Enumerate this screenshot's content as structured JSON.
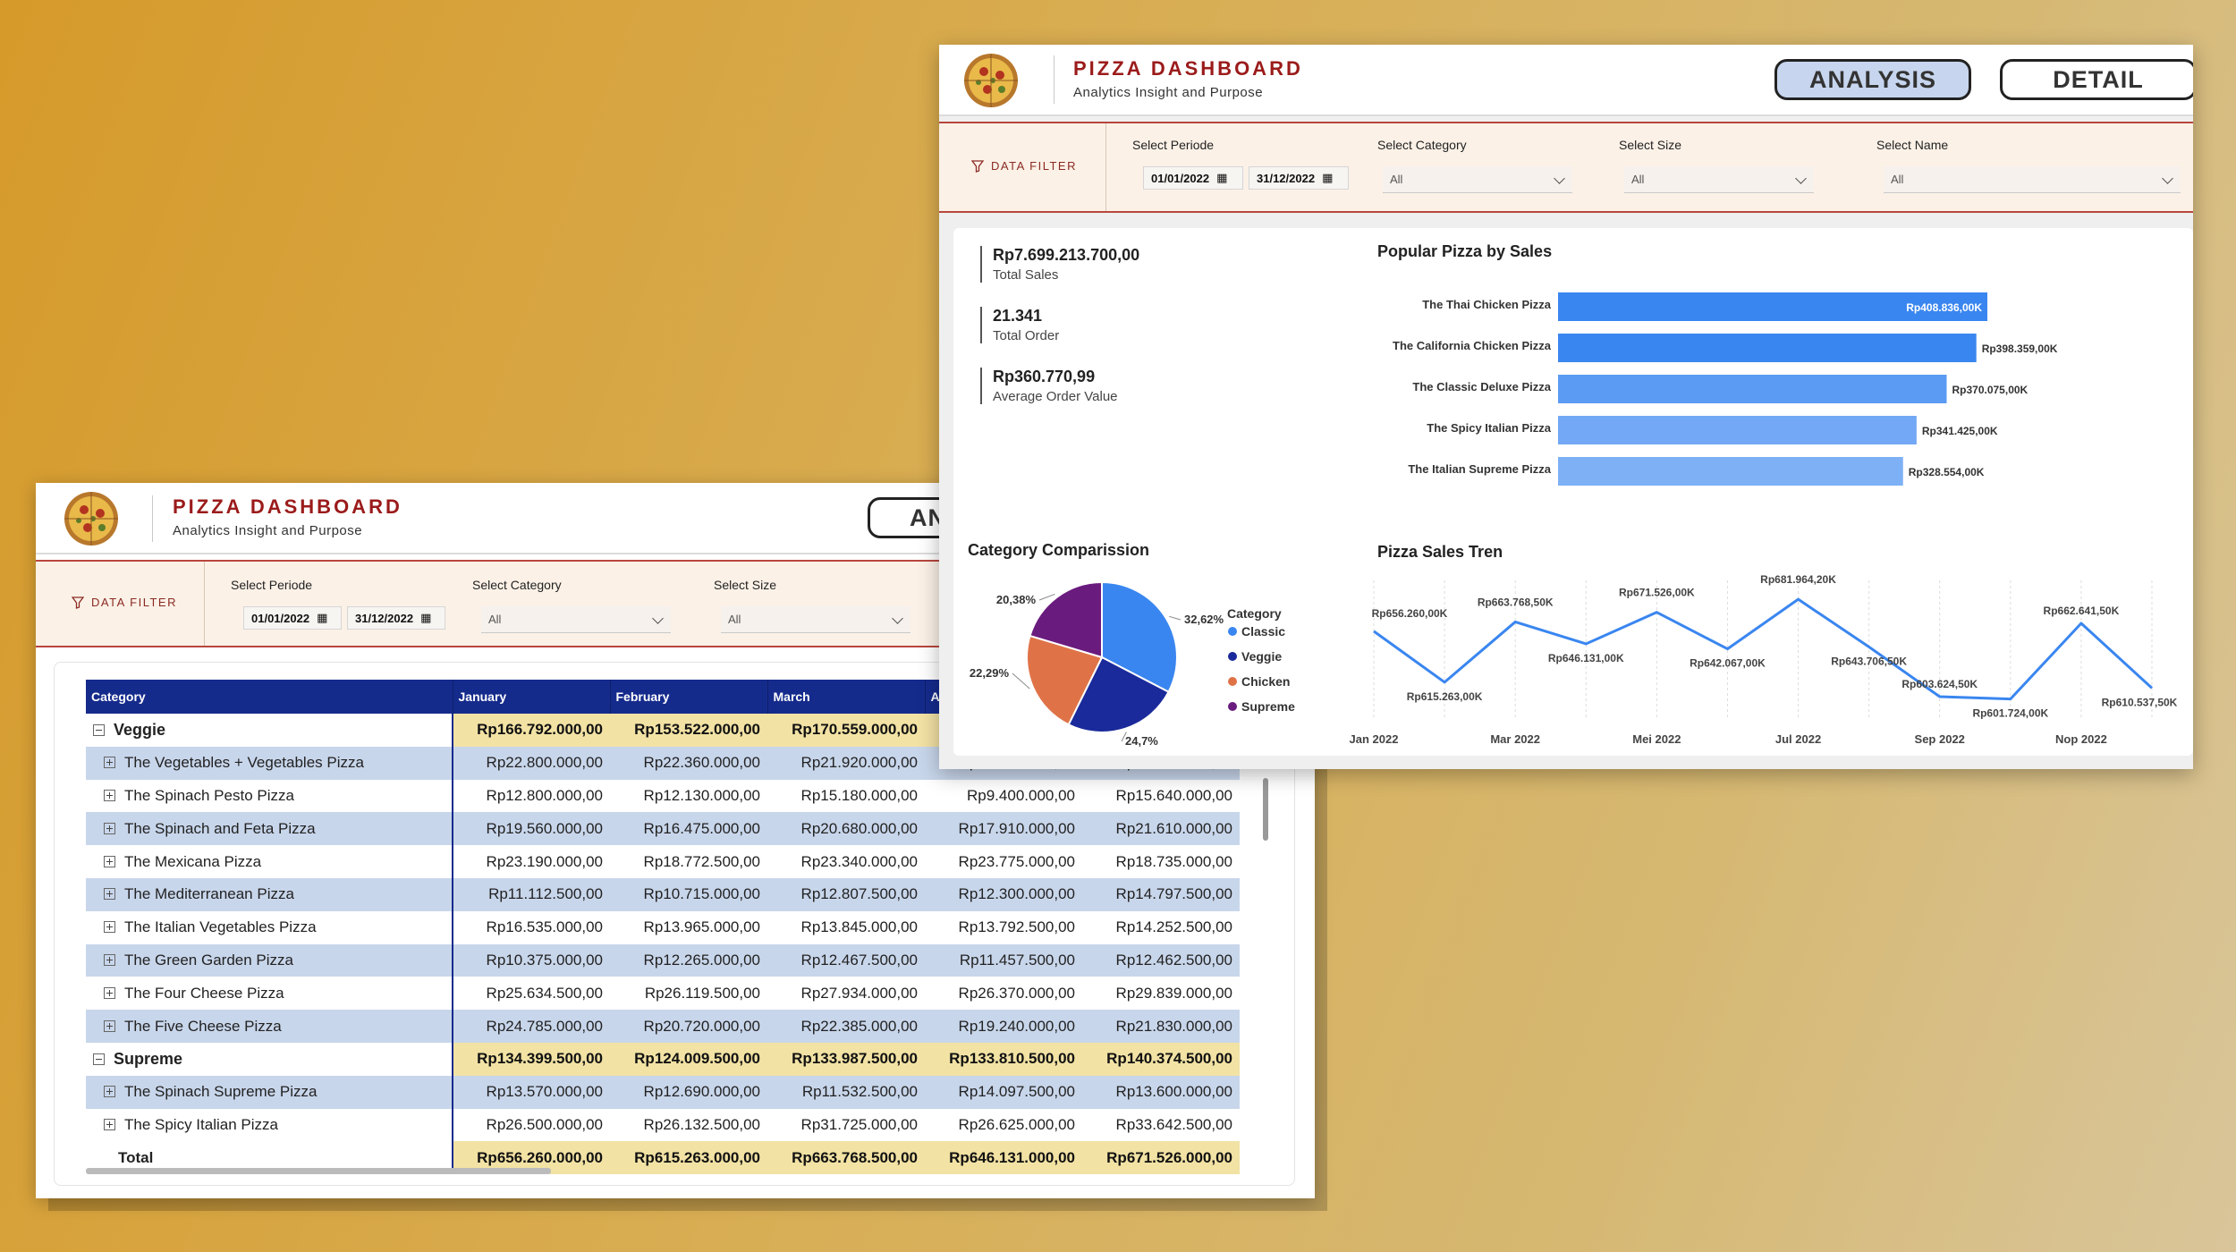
{
  "back_window": {
    "header": {
      "title": "PIZZA DASHBOARD",
      "subtitle": "Analytics Insight and Purpose",
      "nav_partial": "AN"
    },
    "filter": {
      "label": "DATA FILTER",
      "periode_label": "Select Periode",
      "date_from": "01/01/2022",
      "date_to": "31/12/2022",
      "category_label": "Select Category",
      "category_value": "All",
      "size_label": "Select Size",
      "size_value": "All"
    },
    "table": {
      "headers": [
        "Category",
        "January",
        "February",
        "March",
        "A"
      ],
      "rows": [
        {
          "type": "group",
          "label": "Veggie",
          "values": [
            "Rp166.792.000,00",
            "Rp153.522.000,00",
            "Rp170.559.000,00",
            "R",
            ""
          ]
        },
        {
          "type": "item",
          "alt": true,
          "label": "The Vegetables + Vegetables Pizza",
          "values": [
            "Rp22.800.000,00",
            "Rp22.360.000,00",
            "Rp21.920.000,00",
            "Rp20.880.000,00",
            "Rp17.120.000,00"
          ]
        },
        {
          "type": "item",
          "alt": false,
          "label": "The Spinach Pesto Pizza",
          "values": [
            "Rp12.800.000,00",
            "Rp12.130.000,00",
            "Rp15.180.000,00",
            "Rp9.400.000,00",
            "Rp15.640.000,00"
          ]
        },
        {
          "type": "item",
          "alt": true,
          "label": "The Spinach and Feta Pizza",
          "values": [
            "Rp19.560.000,00",
            "Rp16.475.000,00",
            "Rp20.680.000,00",
            "Rp17.910.000,00",
            "Rp21.610.000,00"
          ]
        },
        {
          "type": "item",
          "alt": false,
          "label": "The Mexicana Pizza",
          "values": [
            "Rp23.190.000,00",
            "Rp18.772.500,00",
            "Rp23.340.000,00",
            "Rp23.775.000,00",
            "Rp18.735.000,00"
          ]
        },
        {
          "type": "item",
          "alt": true,
          "label": "The Mediterranean Pizza",
          "values": [
            "Rp11.112.500,00",
            "Rp10.715.000,00",
            "Rp12.807.500,00",
            "Rp12.300.000,00",
            "Rp14.797.500,00"
          ]
        },
        {
          "type": "item",
          "alt": false,
          "label": "The Italian Vegetables Pizza",
          "values": [
            "Rp16.535.000,00",
            "Rp13.965.000,00",
            "Rp13.845.000,00",
            "Rp13.792.500,00",
            "Rp14.252.500,00"
          ]
        },
        {
          "type": "item",
          "alt": true,
          "label": "The Green Garden Pizza",
          "values": [
            "Rp10.375.000,00",
            "Rp12.265.000,00",
            "Rp12.467.500,00",
            "Rp11.457.500,00",
            "Rp12.462.500,00"
          ]
        },
        {
          "type": "item",
          "alt": false,
          "label": "The Four Cheese Pizza",
          "values": [
            "Rp25.634.500,00",
            "Rp26.119.500,00",
            "Rp27.934.000,00",
            "Rp26.370.000,00",
            "Rp29.839.000,00"
          ]
        },
        {
          "type": "item",
          "alt": true,
          "label": "The Five Cheese Pizza",
          "values": [
            "Rp24.785.000,00",
            "Rp20.720.000,00",
            "Rp22.385.000,00",
            "Rp19.240.000,00",
            "Rp21.830.000,00"
          ]
        },
        {
          "type": "group",
          "label": "Supreme",
          "values": [
            "Rp134.399.500,00",
            "Rp124.009.500,00",
            "Rp133.987.500,00",
            "Rp133.810.500,00",
            "Rp140.374.500,00"
          ]
        },
        {
          "type": "item",
          "alt": true,
          "label": "The Spinach Supreme Pizza",
          "values": [
            "Rp13.570.000,00",
            "Rp12.690.000,00",
            "Rp11.532.500,00",
            "Rp14.097.500,00",
            "Rp13.600.000,00"
          ]
        },
        {
          "type": "item",
          "alt": false,
          "label": "The Spicy Italian Pizza",
          "values": [
            "Rp26.500.000,00",
            "Rp26.132.500,00",
            "Rp31.725.000,00",
            "Rp26.625.000,00",
            "Rp33.642.500,00"
          ]
        }
      ],
      "total": {
        "label": "Total",
        "values": [
          "Rp656.260.000,00",
          "Rp615.263.000,00",
          "Rp663.768.500,00",
          "Rp646.131.000,00",
          "Rp671.526.000,00"
        ]
      },
      "trailing_cut": "Rp"
    }
  },
  "front_window": {
    "header": {
      "title": "PIZZA DASHBOARD",
      "subtitle": "Analytics Insight and Purpose",
      "btn_analysis": "ANALYSIS",
      "btn_detail": "DETAIL"
    },
    "filter": {
      "label": "DATA FILTER",
      "periode_label": "Select Periode",
      "date_from": "01/01/2022",
      "date_to": "31/12/2022",
      "category_label": "Select Category",
      "category_value": "All",
      "size_label": "Select Size",
      "size_value": "All",
      "name_label": "Select Name",
      "name_value": "All"
    },
    "kpis": [
      {
        "value": "Rp7.699.213.700,00",
        "label": "Total Sales"
      },
      {
        "value": "21.341",
        "label": "Total Order"
      },
      {
        "value": "Rp360.770,99",
        "label": "Average Order Value"
      }
    ]
  },
  "colors": {
    "brand_red": "#9b1b1b",
    "table_header": "#152b8c",
    "group_row": "#f2e2a4",
    "alt_row": "#c8d6eb"
  },
  "chart_data": [
    {
      "type": "bar",
      "title": "Popular Pizza by Sales",
      "categories": [
        "The Thai Chicken Pizza",
        "The California Chicken Pizza",
        "The Classic Deluxe Pizza",
        "The Spicy Italian Pizza",
        "The Italian Supreme Pizza"
      ],
      "values": [
        408836,
        398359,
        370075,
        341425,
        328554
      ],
      "labels": [
        "Rp408.836,00K",
        "Rp398.359,00K",
        "Rp370.075,00K",
        "Rp341.425,00K",
        "Rp328.554,00K"
      ],
      "colors": [
        "#3a86f0",
        "#3a86f0",
        "#5b9bf3",
        "#72a8f5",
        "#7eb0f6"
      ],
      "orientation": "horizontal"
    },
    {
      "type": "pie",
      "title": "Category Comparission",
      "legend_title": "Category",
      "categories": [
        "Classic",
        "Veggie",
        "Chicken",
        "Supreme"
      ],
      "values": [
        32.62,
        24.7,
        22.29,
        20.38
      ],
      "labels": [
        "32,62%",
        "24,7%",
        "22,29%",
        "20,38%"
      ],
      "colors": [
        "#3a86f0",
        "#1a2a9a",
        "#df7347",
        "#6a1b7e"
      ],
      "legend_position": "right"
    },
    {
      "type": "line",
      "title": "Pizza Sales Tren",
      "x": [
        "Jan 2022",
        "Feb 2022",
        "Mar 2022",
        "Apr 2022",
        "Mei 2022",
        "Jun 2022",
        "Jul 2022",
        "Agu 2022",
        "Sep 2022",
        "Okt 2022",
        "Nop 2022",
        "Des 2022"
      ],
      "x_tick_labels": [
        "Jan 2022",
        "Mar 2022",
        "Mei 2022",
        "Jul 2022",
        "Sep 2022",
        "Nop 2022"
      ],
      "values": [
        656260,
        615263,
        663768.5,
        646131,
        671526,
        642067,
        681964.2,
        643706,
        603624.5,
        601724,
        662641.5,
        610537.5
      ],
      "labels": [
        "Rp656.260,00K",
        "Rp615.263,00K",
        "Rp663.768,50K",
        "Rp646.131,00K",
        "Rp671.526,00K",
        "Rp642.067,00K",
        "Rp681.964,20K",
        "Rp643.706,50K",
        "Rp603.624,50K",
        "Rp601.724,00K",
        "Rp662.641,50K",
        "Rp610.537,50K"
      ],
      "ylim": [
        595000,
        690000
      ],
      "color": "#3a86f0"
    }
  ]
}
